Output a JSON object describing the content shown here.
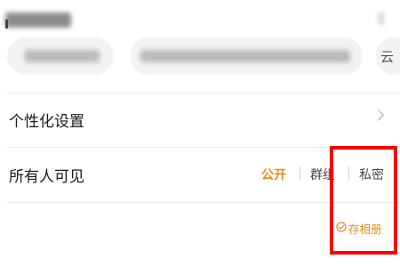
{
  "header": {
    "cloud_char": "云"
  },
  "rows": {
    "personalization": {
      "label": "个性化设置"
    },
    "visibility": {
      "label": "所有人可见"
    }
  },
  "visibility_options": {
    "public": "公开",
    "group": "群组",
    "private": "私密",
    "selected": "公开"
  },
  "save_album": {
    "label": "存相册"
  },
  "colors": {
    "accent": "#e38b1a",
    "highlight_box": "#ff0000",
    "divider": "#ededed"
  },
  "icons": {
    "chevron": "chevron-right-icon",
    "save": "check-circle-icon"
  }
}
